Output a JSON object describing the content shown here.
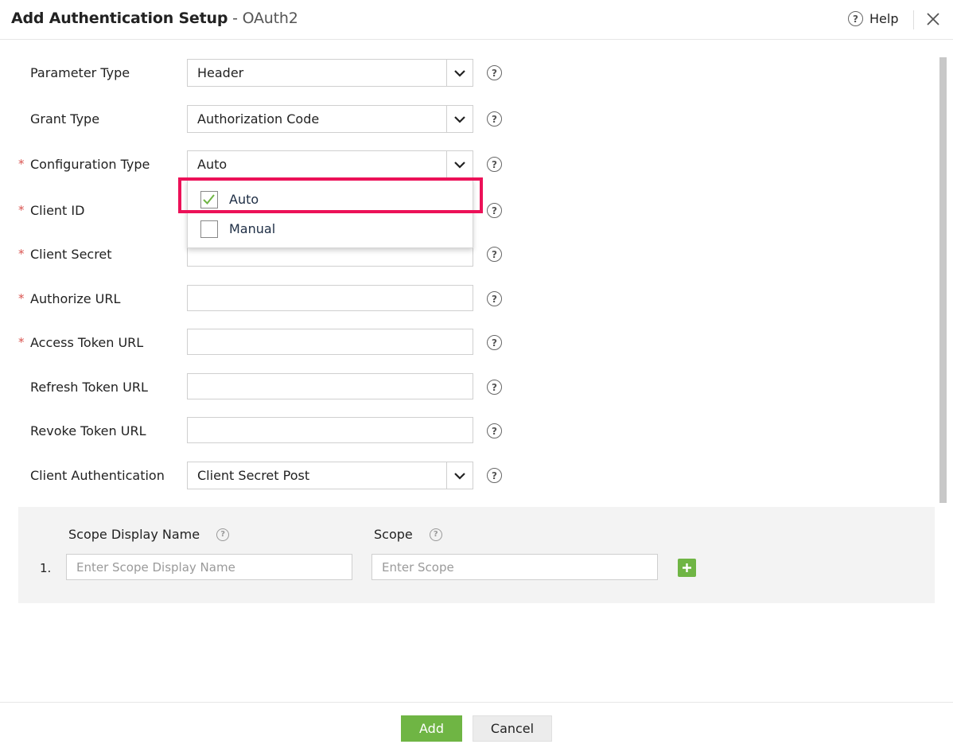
{
  "header": {
    "title": "Add Authentication Setup",
    "separator": " - ",
    "subtitle": "OAuth2",
    "help_label": "Help"
  },
  "form": {
    "parameter_type": {
      "label": "Parameter Type",
      "value": "Header"
    },
    "grant_type": {
      "label": "Grant Type",
      "value": "Authorization Code"
    },
    "configuration_type": {
      "label": "Configuration Type",
      "value": "Auto",
      "required": "*"
    },
    "client_id": {
      "label": "Client ID",
      "required": "*"
    },
    "client_secret": {
      "label": "Client Secret",
      "required": "*"
    },
    "authorize_url": {
      "label": "Authorize URL",
      "required": "*"
    },
    "access_token_url": {
      "label": "Access Token URL",
      "required": "*"
    },
    "refresh_token_url": {
      "label": "Refresh Token URL"
    },
    "revoke_token_url": {
      "label": "Revoke Token URL"
    },
    "client_authentication": {
      "label": "Client Authentication",
      "value": "Client Secret Post"
    }
  },
  "dropdown": {
    "options": [
      {
        "label": "Auto",
        "checked": true
      },
      {
        "label": "Manual",
        "checked": false
      }
    ]
  },
  "scope": {
    "display_name_header": "Scope Display Name",
    "scope_header": "Scope",
    "row_number": "1.",
    "display_name_placeholder": "Enter Scope Display Name",
    "scope_placeholder": "Enter Scope"
  },
  "footer": {
    "add_label": "Add",
    "cancel_label": "Cancel"
  },
  "colors": {
    "accent_green": "#6fb544",
    "highlight": "#ec1158",
    "required": "#d9534f"
  }
}
